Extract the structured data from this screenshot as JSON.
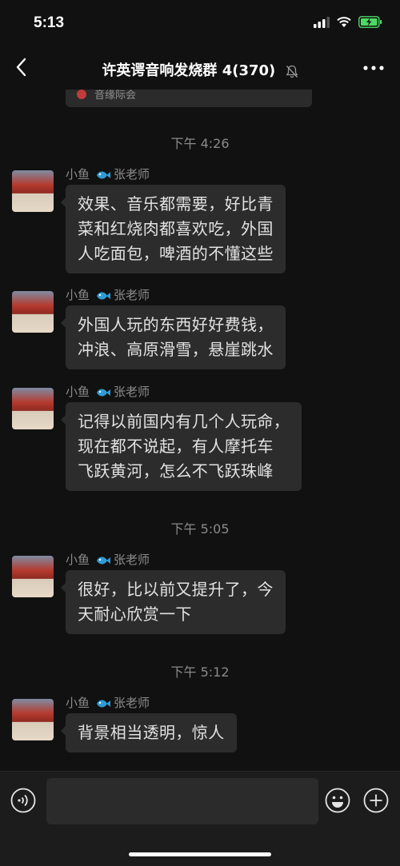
{
  "status_bar": {
    "time": "5:13"
  },
  "header": {
    "title": "许英谔音响发烧群 4(370)"
  },
  "previous_card": {
    "text": "音缘际会"
  },
  "messages": [
    {
      "type": "time",
      "text": "下午 4:26"
    },
    {
      "type": "msg",
      "sender": "小鱼",
      "sender_tag": "张老师",
      "text": "效果、音乐都需要，好比青\n菜和红烧肉都喜欢吃，外国\n人吃面包，啤酒的不懂这些"
    },
    {
      "type": "msg",
      "sender": "小鱼",
      "sender_tag": "张老师",
      "text": "外国人玩的东西好好费钱，\n冲浪、高原滑雪，悬崖跳水"
    },
    {
      "type": "msg",
      "sender": "小鱼",
      "sender_tag": "张老师",
      "text": "记得以前国内有几个人玩命，\n现在都不说起，有人摩托车\n飞跃黄河，怎么不飞跃珠峰"
    },
    {
      "type": "time",
      "text": "下午 5:05"
    },
    {
      "type": "msg",
      "sender": "小鱼",
      "sender_tag": "张老师",
      "text": "很好，比以前又提升了，今\n天耐心欣赏一下"
    },
    {
      "type": "time",
      "text": "下午 5:12"
    },
    {
      "type": "msg",
      "sender": "小鱼",
      "sender_tag": "张老师",
      "text": "背景相当透明，惊人"
    }
  ],
  "input_bar": {
    "placeholder": ""
  },
  "colors": {
    "background": "#111111",
    "bubble": "#2c2c2c",
    "battery": "#4cd964",
    "fish": "#2f9bd6"
  }
}
